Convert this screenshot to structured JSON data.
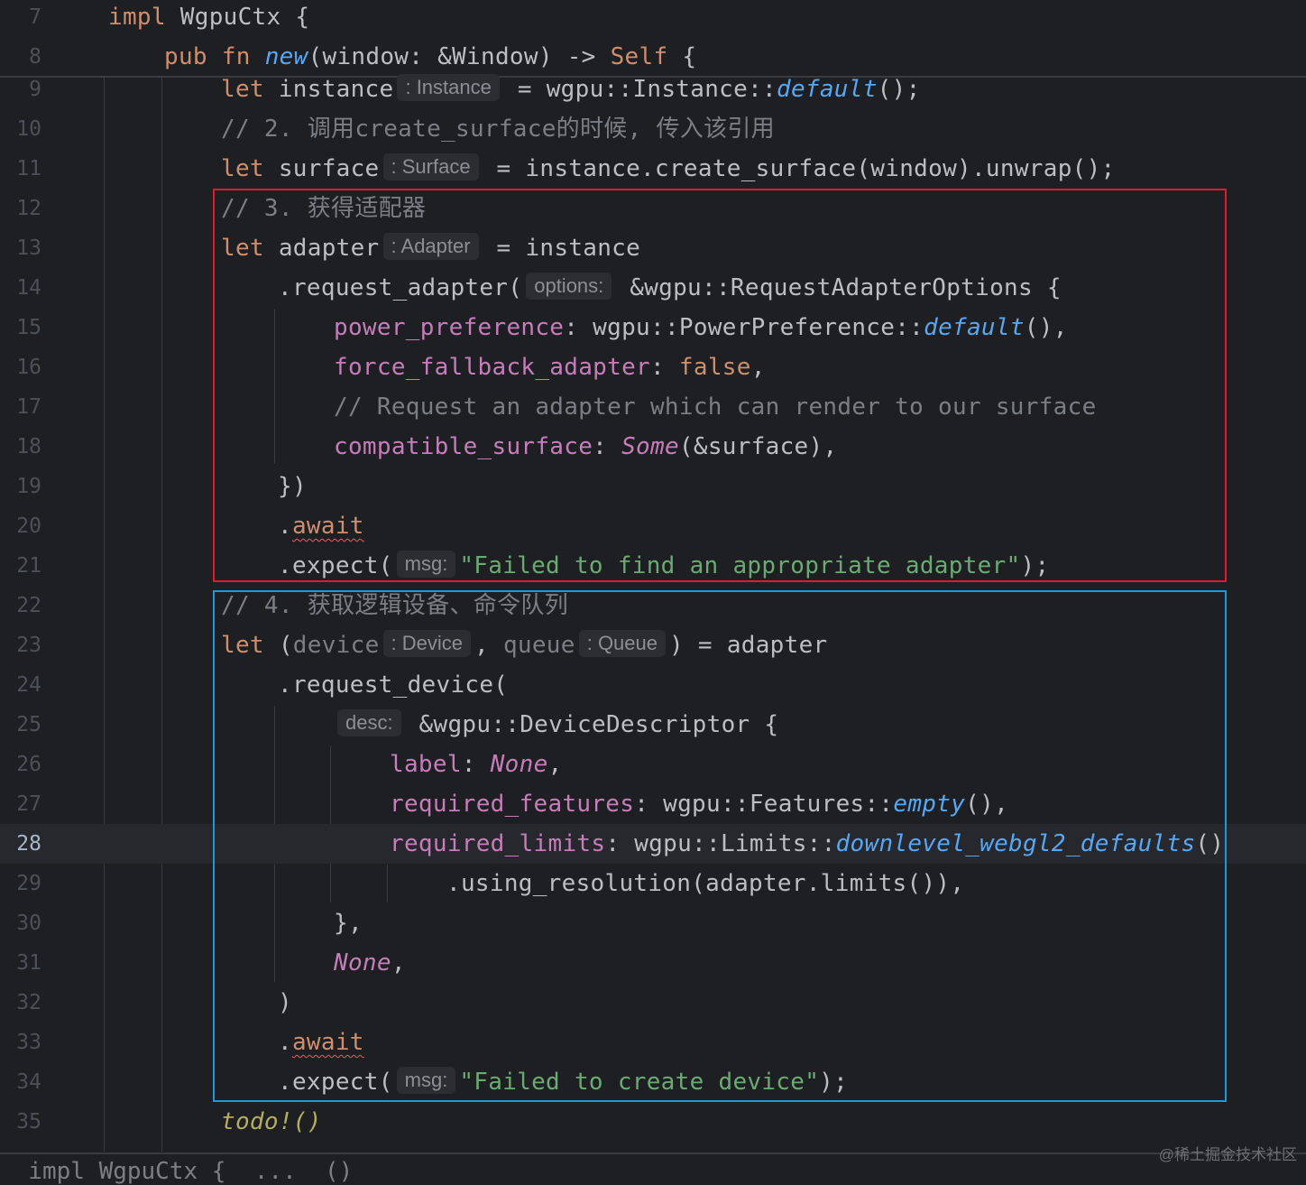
{
  "editor": {
    "current_line": 28,
    "line_numbers": [
      "7",
      "8",
      "9",
      "10",
      "11",
      "12",
      "13",
      "14",
      "15",
      "16",
      "17",
      "18",
      "19",
      "20",
      "21",
      "22",
      "23",
      "24",
      "25",
      "26",
      "27",
      "28",
      "29",
      "30",
      "31",
      "32",
      "33",
      "34",
      "35"
    ],
    "tokens": {
      "impl": "impl ",
      "wgpuctx_open": "WgpuCtx {",
      "pub_fn": "pub fn ",
      "fn_new": "new",
      "new_sig": "(window: &Window) -> ",
      "self_kw": "Self",
      "open_brace": " {",
      "let": "let ",
      "instance_name": "instance",
      "hint_instance": ": Instance",
      "instance_rhs": " = wgpu::Instance::",
      "fn_default": "default",
      "call_end": "();",
      "comment_2": "// 2. 调用create_surface的时候, 传入该引用",
      "surface_name": "surface",
      "hint_surface": ": Surface",
      "surface_rhs": " = instance.create_surface(window).unwrap();",
      "comment_3": "// 3. 获得适配器",
      "adapter_name": "adapter",
      "hint_adapter": ": Adapter",
      "adapter_rhs": " = instance",
      "request_adapter": ".request_adapter(",
      "hint_options": "options:",
      "adapter_options": " &wgpu::RequestAdapterOptions {",
      "power_preference": "power_preference",
      "power_rhs": ": wgpu::PowerPreference::",
      "fn_default2": "default",
      "call_comma": "(),",
      "force_fallback": "force_fallback_adapter",
      "colon_sp": ": ",
      "false_kw": "false",
      "comma": ",",
      "comment_request": "// Request an adapter which can render to our surface",
      "compatible_surface": "compatible_surface",
      "some_kw": "Some",
      "surface_ref": "(&surface),",
      "close_brace_paren": "})",
      "dot": ".",
      "await_kw": "await",
      "expect_open": ".expect(",
      "hint_msg": "msg:",
      "str_adapter": "\"Failed to find an appropriate adapter\"",
      "close_semi": ");",
      "comment_4": "// 4. 获取逻辑设备、命令队列",
      "paren_open": "(",
      "device_name": "device",
      "hint_device": ": Device",
      "comma_sp": ", ",
      "queue_name": "queue",
      "hint_queue": ": Queue",
      "device_rhs": ") = adapter",
      "request_device": ".request_device(",
      "hint_desc": "desc:",
      "device_descriptor": " &wgpu::DeviceDescriptor {",
      "label_prop": "label",
      "none_kw": "None",
      "required_features": "required_features",
      "features_rhs": ": wgpu::Features::",
      "fn_empty": "empty",
      "required_limits": "required_limits",
      "limits_rhs": ": wgpu::Limits::",
      "fn_downlevel": "downlevel_webgl2_defaults",
      "call_parens": "()",
      "using_resolution": ".using_resolution(adapter.limits()),",
      "close_brace_comma": "},",
      "close_paren": ")",
      "str_device": "\"Failed to create device\"",
      "todo_macro": "todo!()",
      "partial_next": "  impl WgpuCtx {  ...  ()"
    }
  },
  "watermark": "@稀土掘金技术社区"
}
